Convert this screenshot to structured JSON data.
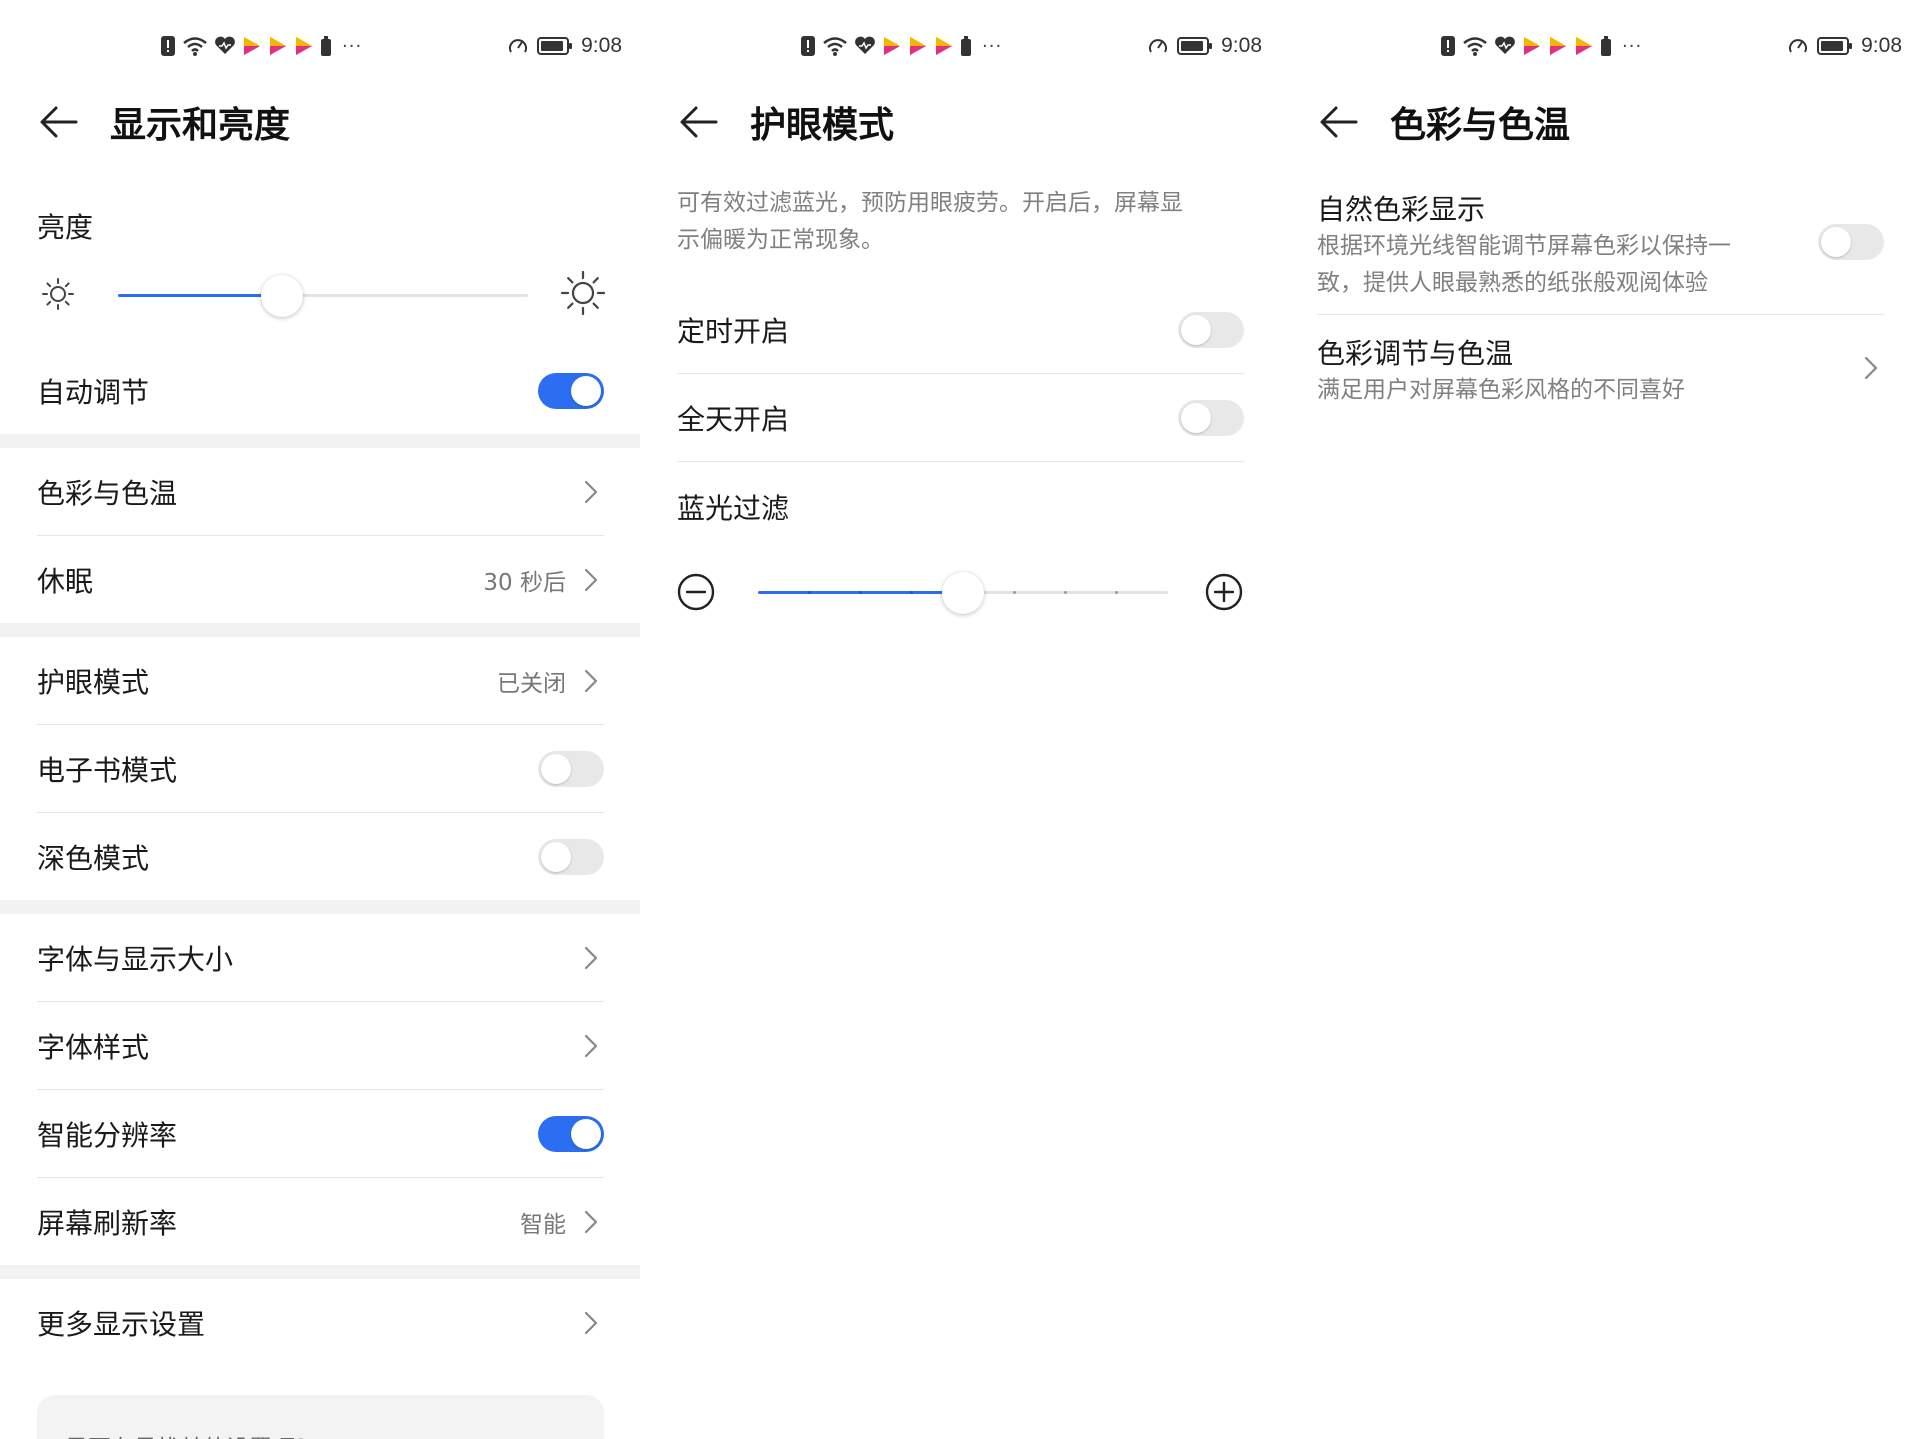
{
  "status_bar": {
    "time": "9:08",
    "more": "···"
  },
  "panel1": {
    "title": "显示和亮度",
    "brightness_label": "亮度",
    "brightness_level": 0.4,
    "auto_adjust": {
      "label": "自动调节",
      "on": true
    },
    "items": [
      {
        "label": "色彩与色温",
        "value": ""
      },
      {
        "label": "休眠",
        "value": "30 秒后"
      },
      {
        "label": "护眼模式",
        "value": "已关闭"
      },
      {
        "label": "电子书模式",
        "on": false
      },
      {
        "label": "深色模式",
        "on": false
      },
      {
        "label": "字体与显示大小",
        "value": ""
      },
      {
        "label": "字体样式",
        "value": ""
      },
      {
        "label": "智能分辨率",
        "on": true
      },
      {
        "label": "屏幕刷新率",
        "value": "智能"
      },
      {
        "label": "更多显示设置",
        "value": ""
      }
    ],
    "suggestion": "是否在寻找其他设置项？"
  },
  "panel2": {
    "title": "护眼模式",
    "description_line1": "可有效过滤蓝光，预防用眼疲劳。开启后，屏幕显",
    "description_line2": "示偏暖为正常现象。",
    "scheduled": {
      "label": "定时开启",
      "on": false
    },
    "all_day": {
      "label": "全天开启",
      "on": false
    },
    "filter_label": "蓝光过滤",
    "filter_level": 0.5
  },
  "panel3": {
    "title": "色彩与色温",
    "natural": {
      "label": "自然色彩显示",
      "desc_line1": "根据环境光线智能调节屏幕色彩以保持一",
      "desc_line2": "致，提供人眼最熟悉的纸张般观阅体验",
      "on": false
    },
    "color_adjust": {
      "label": "色彩调节与色温",
      "desc": "满足用户对屏幕色彩风格的不同喜好"
    }
  },
  "colors": {
    "accent": "#2b6ef2",
    "divider": "#e6e6e6",
    "section_gap": "#f2f2f2"
  }
}
